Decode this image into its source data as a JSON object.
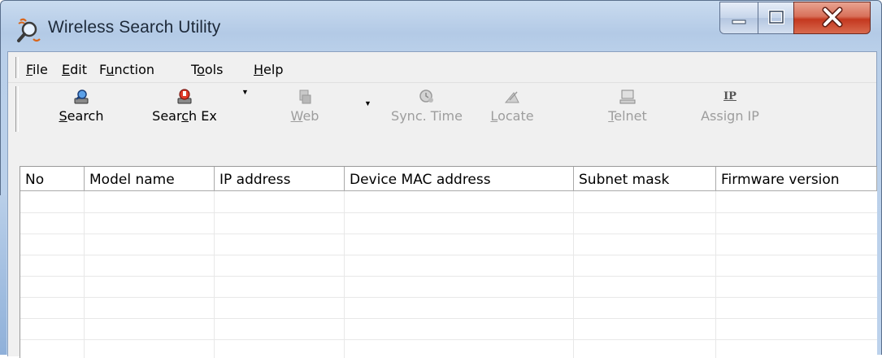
{
  "window": {
    "title": "Wireless Search Utility",
    "app_icon": "magnifier-search-icon",
    "controls": [
      "minimize-icon",
      "maximize-icon",
      "close-icon"
    ]
  },
  "menu": {
    "file": {
      "pre": "",
      "key": "F",
      "post": "ile"
    },
    "edit": {
      "pre": "",
      "key": "E",
      "post": "dit"
    },
    "function": {
      "pre": "F",
      "key": "u",
      "post": "nction"
    },
    "tools": {
      "pre": "T",
      "key": "o",
      "post": "ols"
    },
    "help": {
      "pre": "",
      "key": "H",
      "post": "elp"
    }
  },
  "toolbar": {
    "search": {
      "pre": "",
      "key": "S",
      "post": "earch",
      "icon": "search-icon",
      "enabled": true
    },
    "search_ex": {
      "pre": "Sear",
      "key": "c",
      "post": "h Ex",
      "icon": "search-ex-icon",
      "enabled": true
    },
    "web": {
      "pre": "",
      "key": "W",
      "post": "eb",
      "icon": "web-icon",
      "enabled": false
    },
    "sync_time": {
      "pre": "Sync. Time",
      "key": "",
      "post": "",
      "icon": "sync-time-icon",
      "enabled": false
    },
    "locate": {
      "pre": "",
      "key": "L",
      "post": "ocate",
      "icon": "locate-icon",
      "enabled": false
    },
    "telnet": {
      "pre": "",
      "key": "T",
      "post": "elnet",
      "icon": "telnet-icon",
      "enabled": false
    },
    "assign_ip": {
      "pre": "Assi",
      "key": "g",
      "post": "n IP",
      "icon": "assign-ip-icon",
      "icon_text": "IP",
      "enabled": false
    }
  },
  "table": {
    "columns": [
      "No",
      "Model name",
      "IP address",
      "Device MAC address",
      "Subnet mask",
      "Firmware version"
    ],
    "rows": []
  }
}
